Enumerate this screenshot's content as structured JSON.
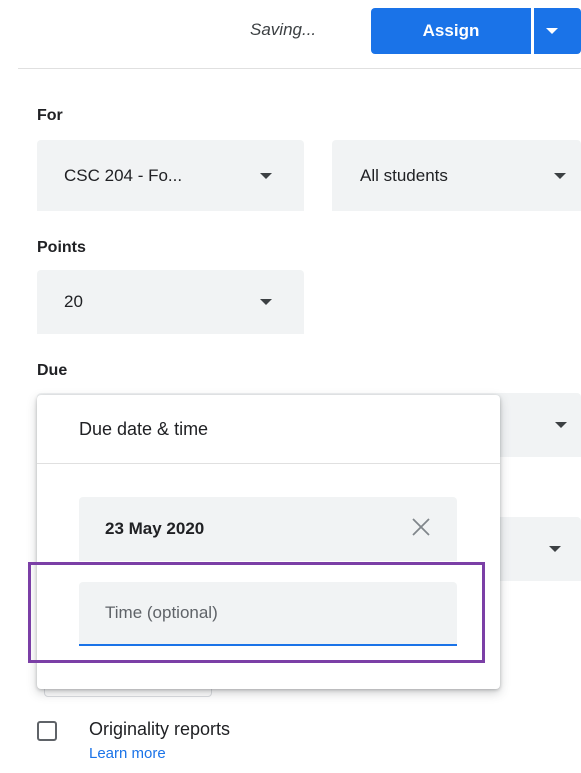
{
  "header": {
    "status": "Saving...",
    "assign_label": "Assign"
  },
  "for_section": {
    "label": "For",
    "class_value": "CSC 204 - Fo...",
    "students_value": "All students"
  },
  "points_section": {
    "label": "Points",
    "value": "20"
  },
  "due_section": {
    "label": "Due"
  },
  "due_popup": {
    "title": "Due date & time",
    "date_value": "23 May 2020",
    "time_placeholder": "Time (optional)"
  },
  "originality": {
    "label": "Originality reports",
    "link": "Learn more"
  },
  "colors": {
    "accent": "#1a73e8",
    "highlight": "#7b3fa6"
  }
}
